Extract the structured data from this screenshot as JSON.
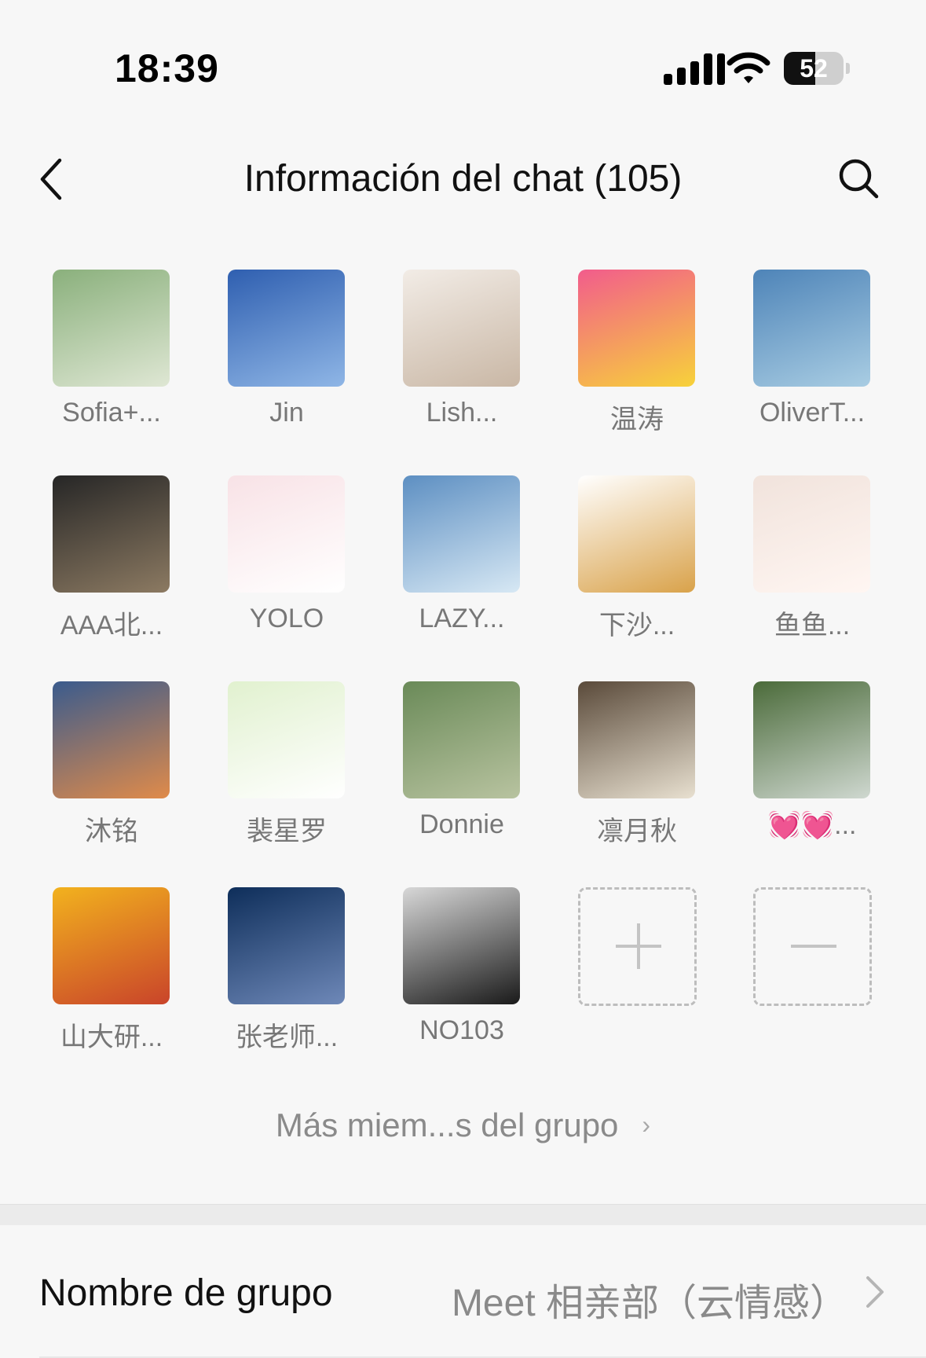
{
  "status_bar": {
    "time": "18:39",
    "battery": "52",
    "battery_level": 0.52
  },
  "header": {
    "title": "Información del chat (105)",
    "back_icon": "chevron-left-icon",
    "search_icon": "search-icon"
  },
  "members": [
    {
      "name": "Sofia+...",
      "colors": [
        "#8ab07c",
        "#dfe7d4"
      ]
    },
    {
      "name": "Jin",
      "colors": [
        "#2f5fb0",
        "#8fb6e6"
      ]
    },
    {
      "name": "Lish...",
      "colors": [
        "#f2ece6",
        "#c9b7a5"
      ]
    },
    {
      "name": "温涛",
      "colors": [
        "#f25c8c",
        "#f7d23a"
      ]
    },
    {
      "name": "OliverT...",
      "colors": [
        "#4e84b8",
        "#a9cde3"
      ]
    },
    {
      "name": "AAA北...",
      "colors": [
        "#262626",
        "#8c7a62"
      ]
    },
    {
      "name": "YOLO",
      "colors": [
        "#f8e2e6",
        "#ffffff"
      ]
    },
    {
      "name": "LAZY...",
      "colors": [
        "#5d8fc2",
        "#d7e8f4"
      ]
    },
    {
      "name": "下沙...",
      "colors": [
        "#ffffff",
        "#d9a24a"
      ]
    },
    {
      "name": "鱼鱼...",
      "colors": [
        "#f1e3dc",
        "#fff6f2"
      ]
    },
    {
      "name": "沐铭",
      "colors": [
        "#3a5b8d",
        "#e08b4a"
      ]
    },
    {
      "name": "裴星罗",
      "colors": [
        "#e1f1cf",
        "#ffffff"
      ]
    },
    {
      "name": "Donnie",
      "colors": [
        "#6a8a58",
        "#b8c3a0"
      ]
    },
    {
      "name": "凛月秋",
      "colors": [
        "#5a4a3a",
        "#e8e0d0"
      ]
    },
    {
      "name": "💓💓...",
      "colors": [
        "#4b6b3a",
        "#cfd8d0"
      ]
    },
    {
      "name": "山大研...",
      "colors": [
        "#f2b21e",
        "#c9442a"
      ]
    },
    {
      "name": "张老师...",
      "colors": [
        "#0e2e5a",
        "#6e88b8"
      ]
    },
    {
      "name": "NO103",
      "colors": [
        "#d8d8d8",
        "#1a1a1a"
      ]
    }
  ],
  "add_button": "plus-icon",
  "remove_button": "minus-icon",
  "more_members": {
    "label": "Más miem...s del grupo"
  },
  "group_name_row": {
    "label": "Nombre de grupo",
    "value": "Meet 相亲部（云情感）"
  }
}
